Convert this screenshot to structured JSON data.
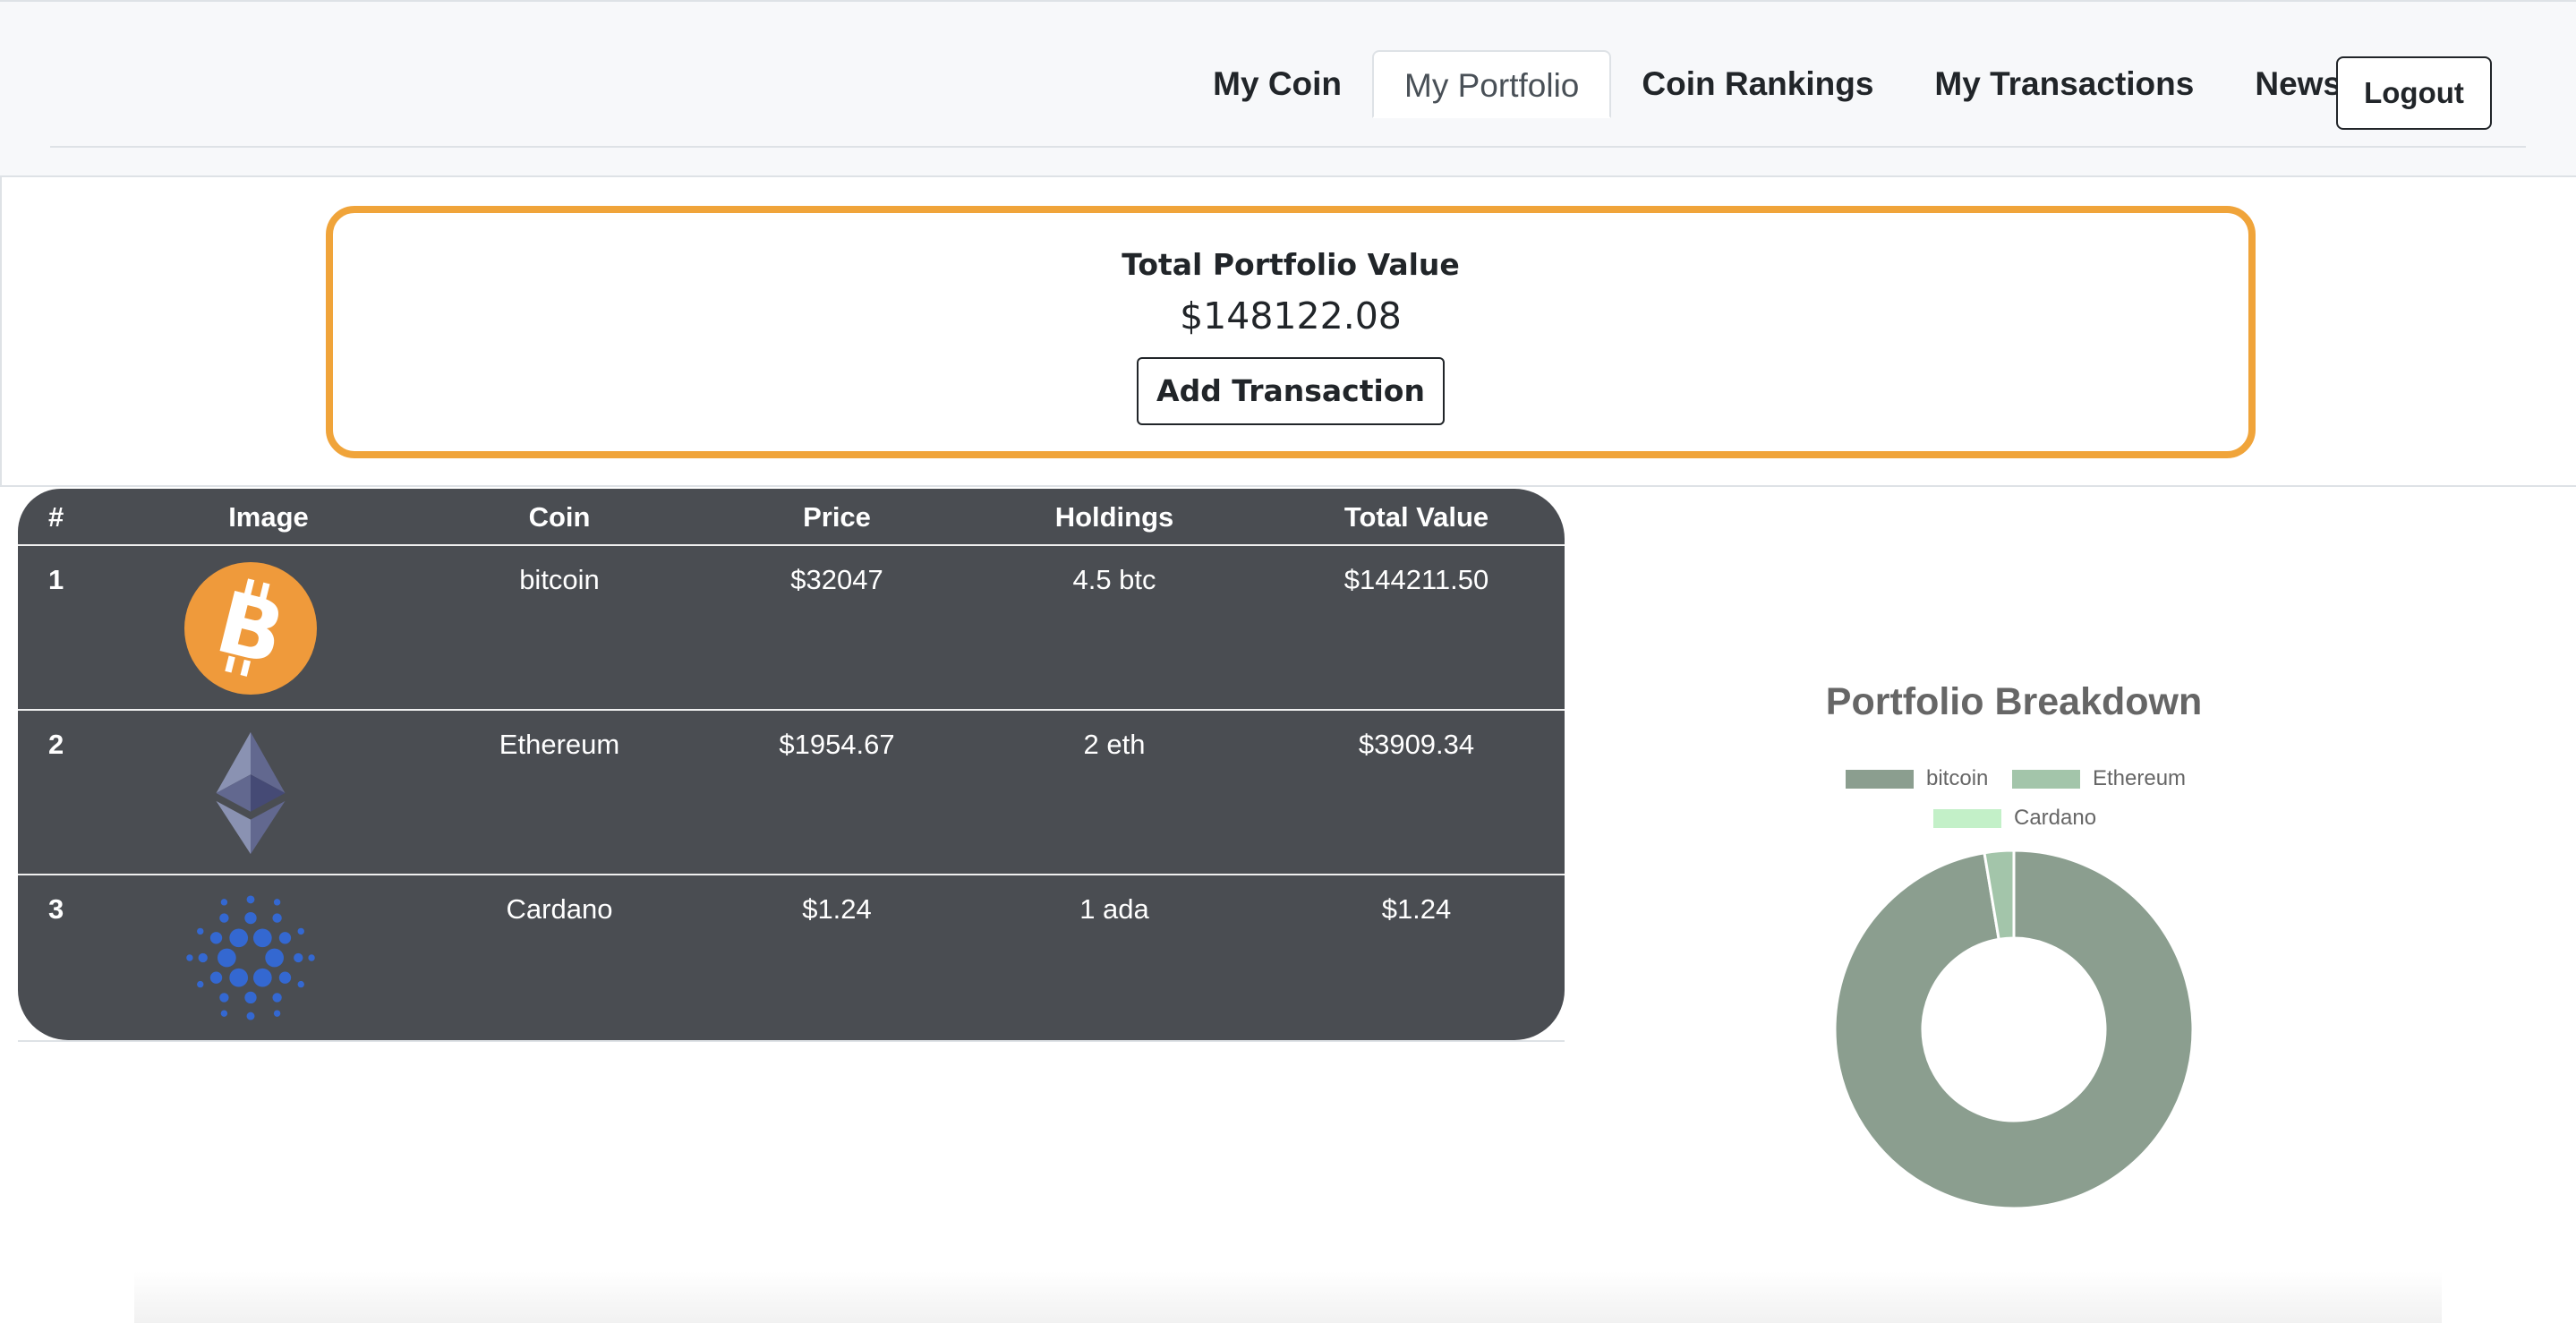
{
  "nav": {
    "items": [
      "My Coin",
      "My Portfolio",
      "Coin Rankings",
      "My Transactions",
      "News"
    ],
    "active": "My Portfolio",
    "logout_label": "Logout"
  },
  "summary": {
    "title": "Total Portfolio Value",
    "value": "$148122.08",
    "add_label": "Add Transaction"
  },
  "holdings": {
    "columns": [
      "#",
      "Image",
      "Coin",
      "Price",
      "Holdings",
      "Total Value"
    ],
    "rows": [
      {
        "rank": "1",
        "coin": "bitcoin",
        "price": "$32047",
        "holdings": "4.5 btc",
        "total": "$144211.50",
        "icon": "bitcoin-icon"
      },
      {
        "rank": "2",
        "coin": "Ethereum",
        "price": "$1954.67",
        "holdings": "2 eth",
        "total": "$3909.34",
        "icon": "ethereum-icon"
      },
      {
        "rank": "3",
        "coin": "Cardano",
        "price": "$1.24",
        "holdings": "1 ada",
        "total": "$1.24",
        "icon": "cardano-icon"
      }
    ]
  },
  "colors": {
    "accent_border": "#f0a43a",
    "table_bg": "#4a4d52",
    "bitcoin": "#8b9e8f",
    "ethereum": "#a3c5aa",
    "cardano": "#c3f0c8"
  },
  "chart_data": {
    "type": "pie",
    "title": "Portfolio Breakdown",
    "categories": [
      "bitcoin",
      "Ethereum",
      "Cardano"
    ],
    "values": [
      144211.5,
      3909.34,
      1.24
    ],
    "colors": [
      "#8b9e8f",
      "#a3c5aa",
      "#c3f0c8"
    ],
    "legend": "top"
  }
}
